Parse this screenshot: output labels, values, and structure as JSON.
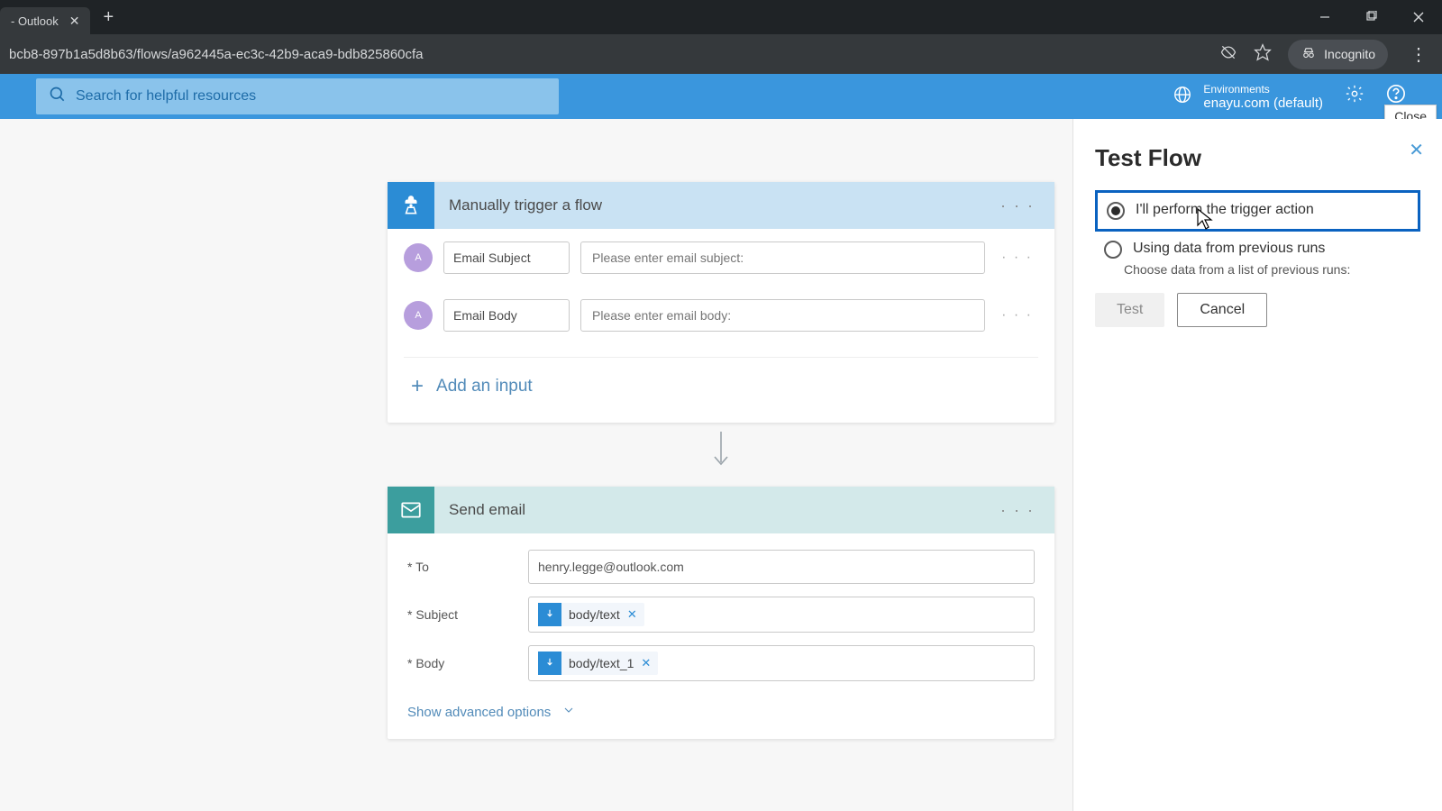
{
  "browser": {
    "tab_title": " - Outlook",
    "address": "bcb8-897b1a5d8b63/flows/a962445a-ec3c-42b9-aca9-bdb825860cfa",
    "incognito_label": "Incognito"
  },
  "header": {
    "search_placeholder": "Search for helpful resources",
    "environments_label": "Environments",
    "environment_value": "enayu.com (default)",
    "close_tooltip": "Close"
  },
  "trigger_card": {
    "title": "Manually trigger a flow",
    "inputs": [
      {
        "name": "Email Subject",
        "placeholder": "Please enter email subject:"
      },
      {
        "name": "Email Body",
        "placeholder": "Please enter email body:"
      }
    ],
    "add_input_label": "Add an input"
  },
  "send_card": {
    "title": "Send email",
    "to_label": "* To",
    "to_value": "henry.legge@outlook.com",
    "subject_label": "* Subject",
    "subject_token": "body/text",
    "body_label": "* Body",
    "body_token": "body/text_1",
    "advanced_label": "Show advanced options"
  },
  "panel": {
    "title": "Test Flow",
    "option_manual": "I'll perform the trigger action",
    "option_previous": "Using data from previous runs",
    "option_previous_sub": "Choose data from a list of previous runs:",
    "test_label": "Test",
    "cancel_label": "Cancel"
  }
}
